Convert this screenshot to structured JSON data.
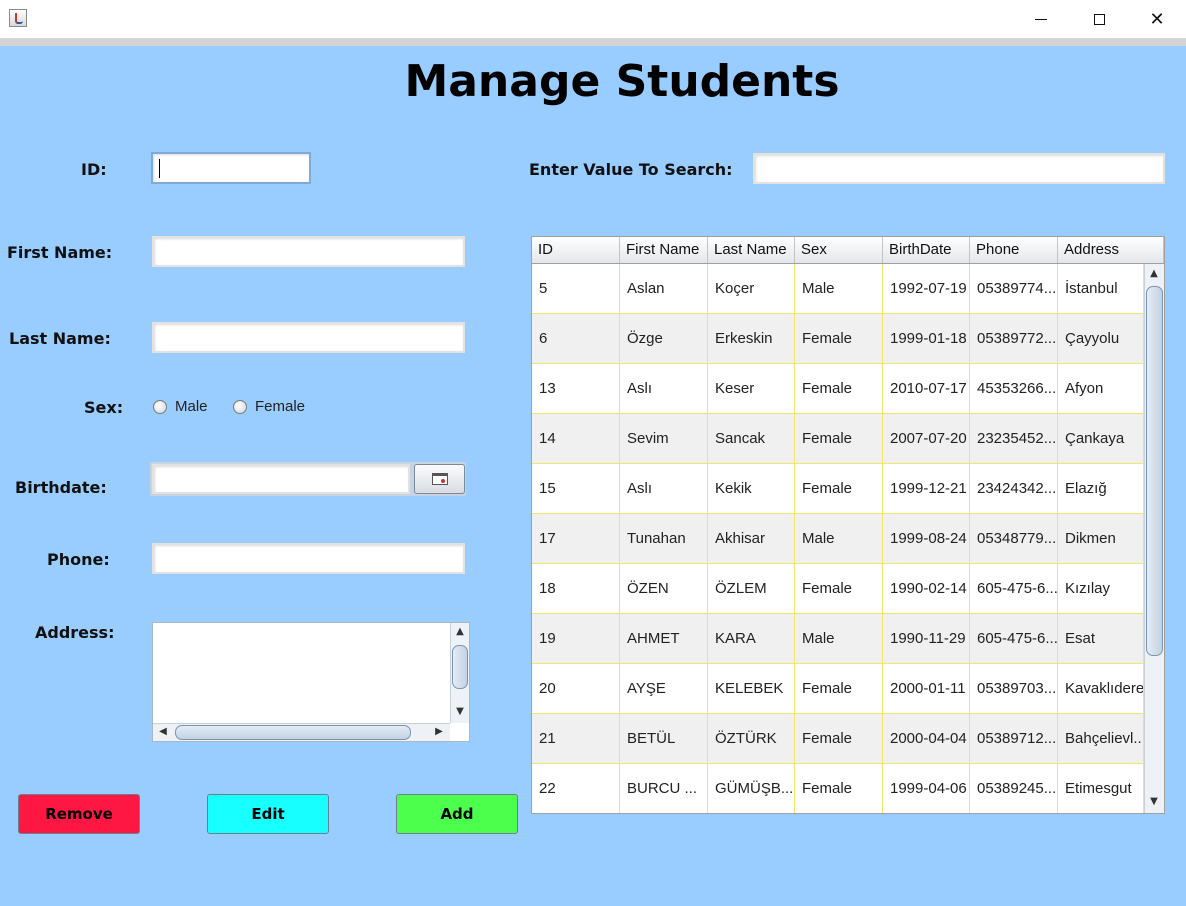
{
  "window": {
    "app_icon": "java-cup-icon",
    "controls": {
      "minimize": "minimize-icon",
      "maximize": "maximize-icon",
      "close": "✕"
    }
  },
  "page_title": "Manage Students",
  "form": {
    "id_label": "ID:",
    "id_value": "",
    "first_name_label": "First Name:",
    "first_name_value": "",
    "last_name_label": "Last Name:",
    "last_name_value": "",
    "sex_label": "Sex:",
    "sex_options": [
      "Male",
      "Female"
    ],
    "birthdate_label": "Birthdate:",
    "birthdate_value": "",
    "phone_label": "Phone:",
    "phone_value": "",
    "address_label": "Address:",
    "address_value": ""
  },
  "buttons": {
    "remove": "Remove",
    "edit": "Edit",
    "add": "Add"
  },
  "colors": {
    "background": "#99ccff",
    "remove": "#ff1744",
    "edit": "#18ffff",
    "add": "#4cff4c",
    "grid_line": "#f2e66a"
  },
  "search": {
    "label": "Enter Value To Search:",
    "value": ""
  },
  "table": {
    "columns": [
      "ID",
      "First Name",
      "Last Name",
      "Sex",
      "BirthDate",
      "Phone",
      "Address"
    ],
    "rows": [
      [
        "5",
        "Aslan",
        "Koçer",
        "Male",
        "1992-07-19",
        "05389774...",
        "İstanbul"
      ],
      [
        "6",
        "Özge",
        "Erkeskin",
        "Female",
        "1999-01-18",
        "05389772...",
        "Çayyolu"
      ],
      [
        "13",
        "Aslı",
        "Keser",
        "Female",
        "2010-07-17",
        "45353266...",
        "Afyon"
      ],
      [
        "14",
        "Sevim",
        "Sancak",
        "Female",
        "2007-07-20",
        "23235452...",
        "Çankaya"
      ],
      [
        "15",
        "Aslı",
        "Kekik",
        "Female",
        "1999-12-21",
        "23424342...",
        "Elazığ"
      ],
      [
        "17",
        "Tunahan",
        "Akhisar",
        "Male",
        "1999-08-24",
        "05348779...",
        "Dikmen"
      ],
      [
        "18",
        "ÖZEN",
        "ÖZLEM",
        "Female",
        "1990-02-14",
        "605-475-6...",
        "Kızılay"
      ],
      [
        "19",
        "AHMET",
        "KARA",
        "Male",
        "1990-11-29",
        "605-475-6...",
        "Esat"
      ],
      [
        "20",
        "AYŞE",
        "KELEBEK",
        "Female",
        "2000-01-11",
        "05389703...",
        "Kavaklıdere"
      ],
      [
        "21",
        "BETÜL",
        "ÖZTÜRK",
        "Female",
        "2000-04-04",
        "05389712...",
        "Bahçelievl..."
      ],
      [
        "22",
        "BURCU ...",
        "GÜMÜŞB...",
        "Female",
        "1999-04-06",
        "05389245...",
        "Etimesgut"
      ]
    ]
  }
}
